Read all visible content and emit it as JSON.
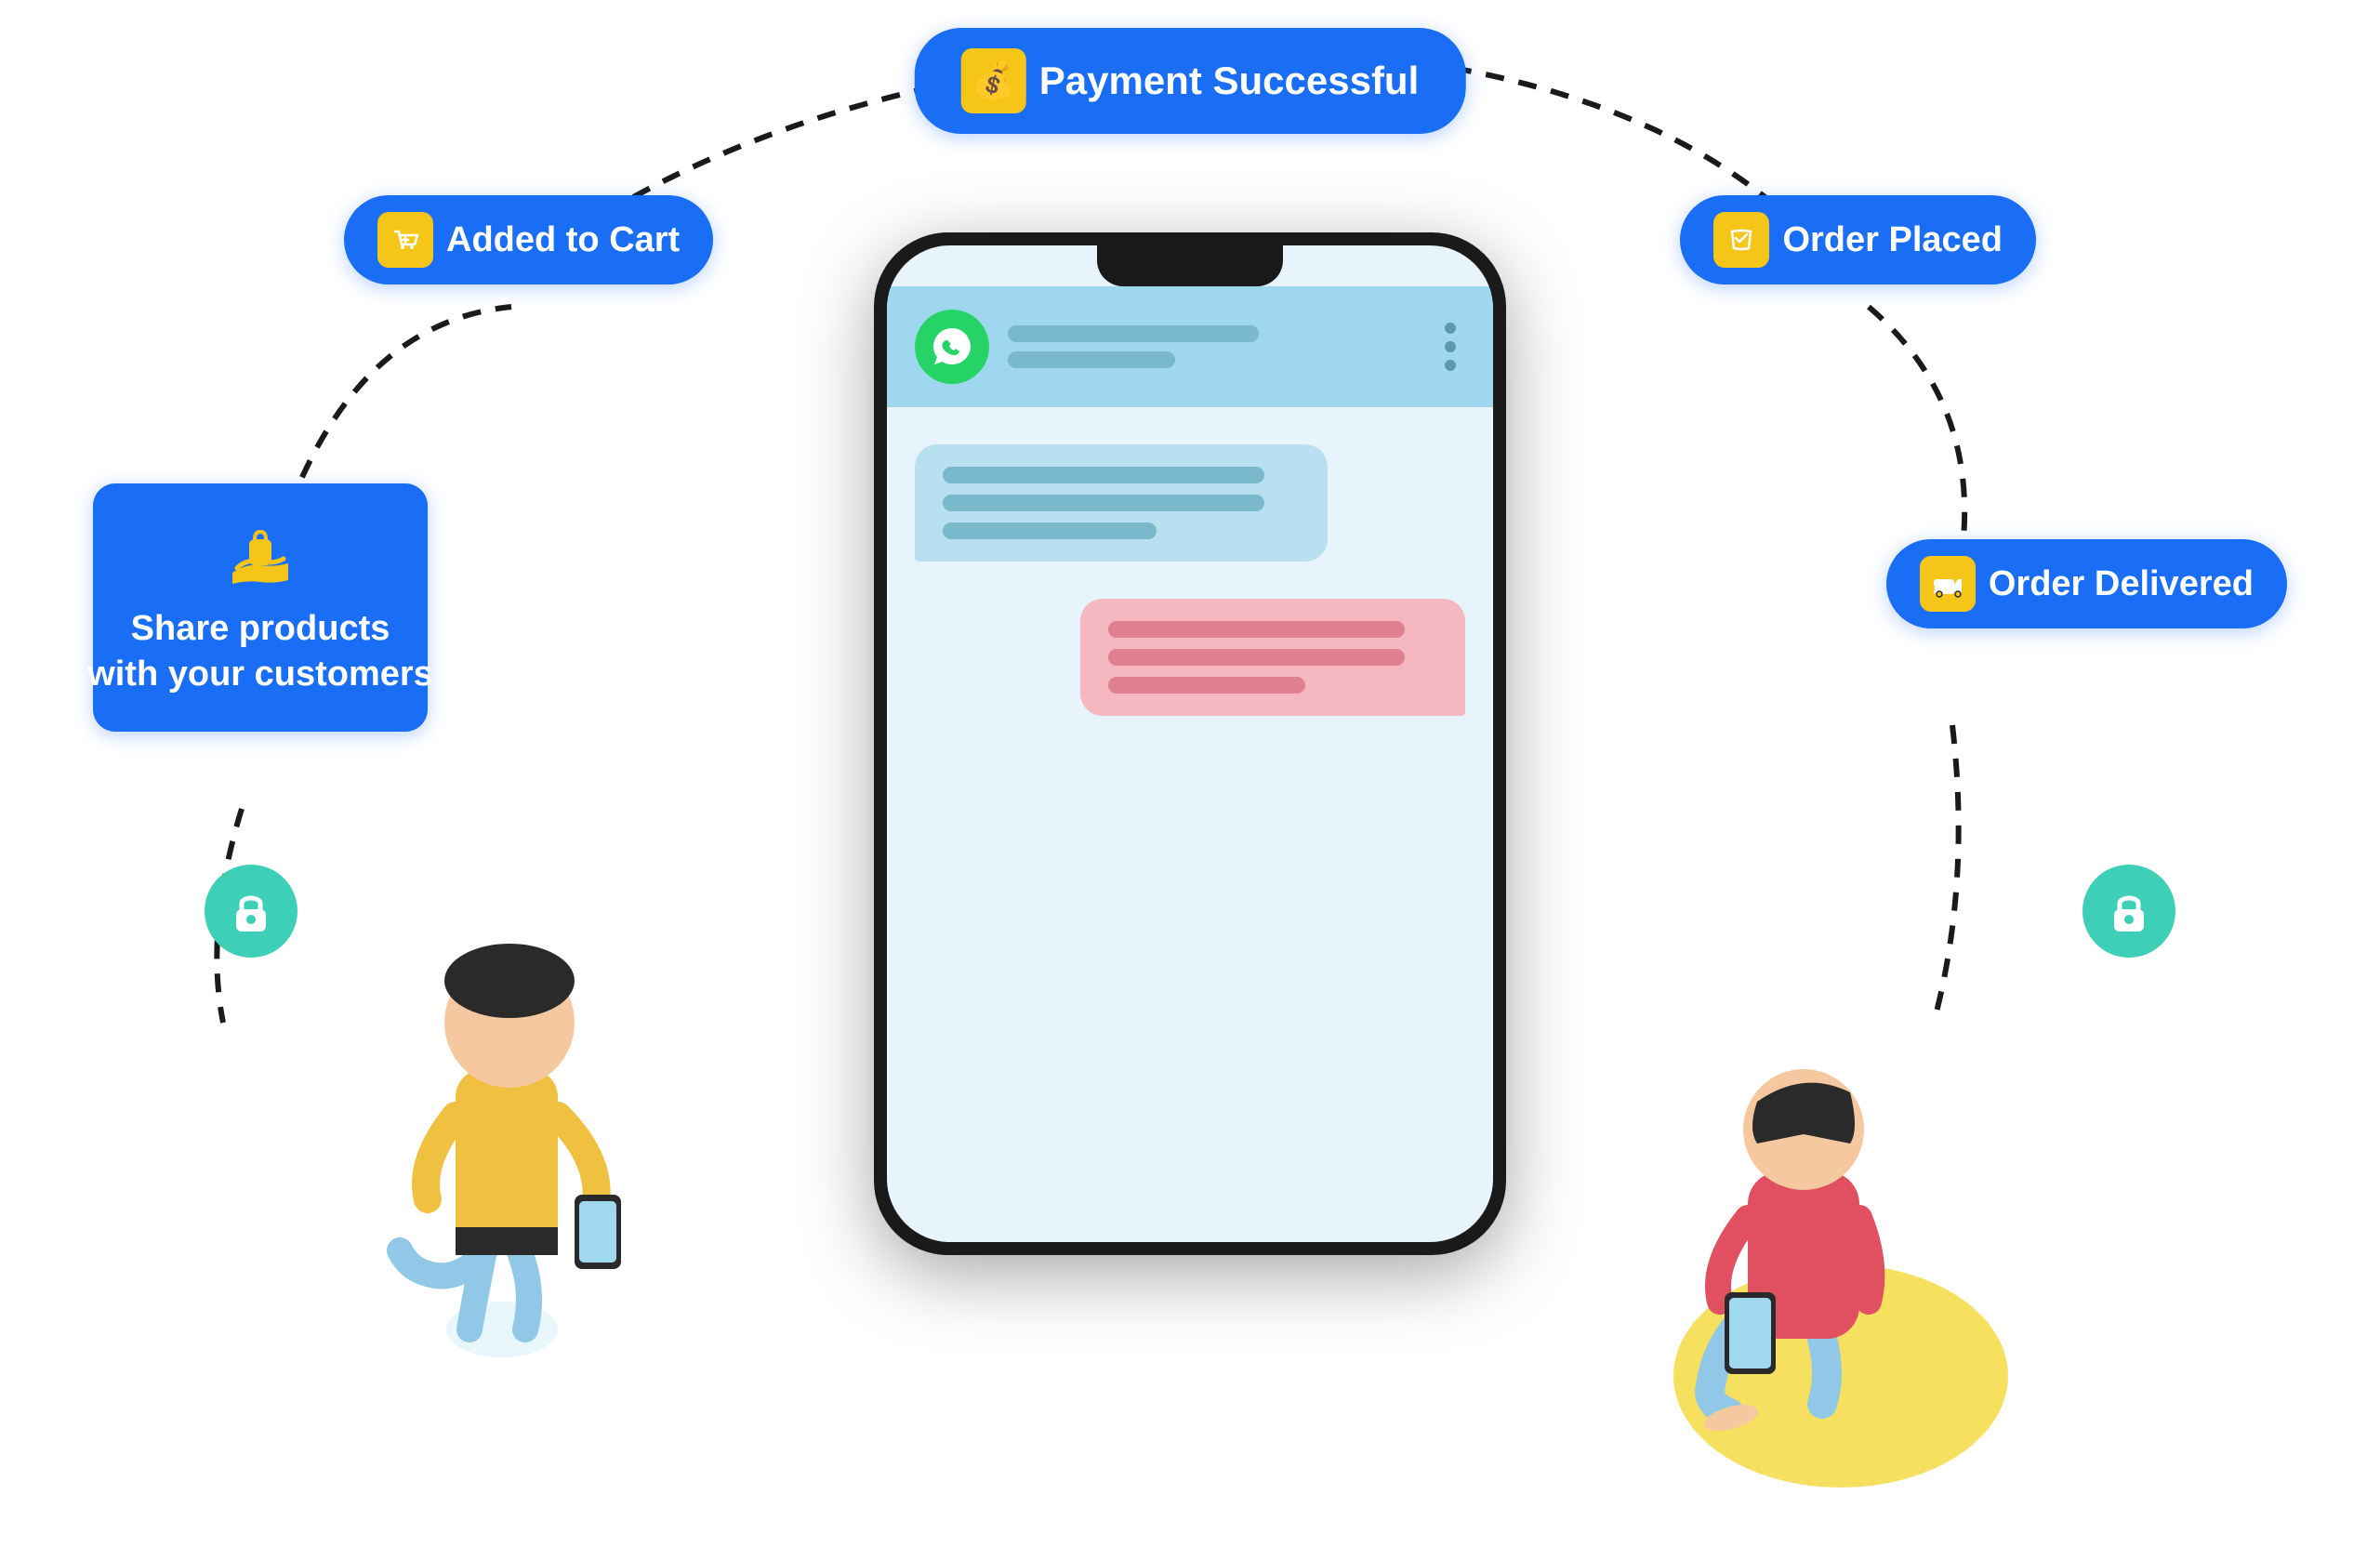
{
  "badges": {
    "payment": {
      "label": "Payment Successful",
      "icon": "💰"
    },
    "cart": {
      "label": "Added to Cart",
      "icon": "🛒"
    },
    "orderPlaced": {
      "label": "Order Placed",
      "icon": "🛍️"
    },
    "share": {
      "line1": "Share products",
      "line2": "with your customers",
      "icon": "🛍️"
    },
    "orderDelivered": {
      "label": "Order Delivered",
      "icon": "🚚"
    }
  },
  "colors": {
    "blue": "#1a6ef5",
    "yellow": "#f5c518",
    "teal": "#3ecfb8",
    "whatsapp": "#25d366"
  }
}
